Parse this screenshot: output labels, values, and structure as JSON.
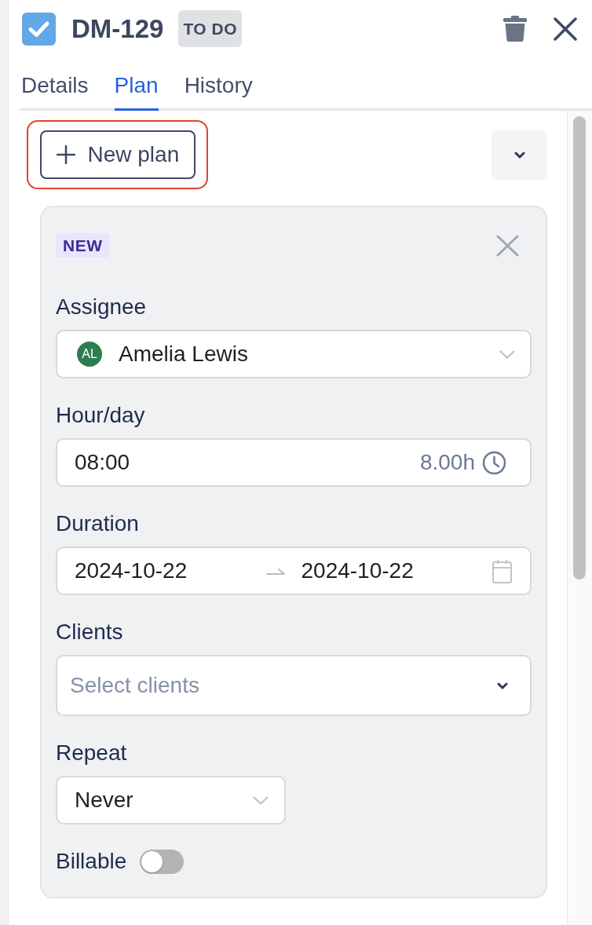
{
  "task": {
    "checked": true,
    "key": "DM-129",
    "status": "TO DO"
  },
  "tabs": [
    {
      "label": "Details",
      "selected": false
    },
    {
      "label": "Plan",
      "selected": true
    },
    {
      "label": "History",
      "selected": false
    }
  ],
  "toolbar": {
    "new_plan": {
      "label": "New plan",
      "highlighted": true
    }
  },
  "plan": {
    "badge": "NEW",
    "fields": [
      {
        "kind": "select",
        "label": "Assignee",
        "avatar": "AL",
        "value": "Amelia Lewis"
      },
      {
        "kind": "time",
        "label": "Hour/day",
        "value": "08:00",
        "hint": "8.00h"
      },
      {
        "kind": "date-range",
        "label": "Duration",
        "start": "2024-10-22",
        "end": "2024-10-22"
      },
      {
        "kind": "multi-select",
        "label": "Clients",
        "placeholder": "Select clients"
      },
      {
        "kind": "short-select",
        "label": "Repeat",
        "value": "Never"
      },
      {
        "kind": "toggle",
        "label": "Billable",
        "on": false
      }
    ]
  }
}
